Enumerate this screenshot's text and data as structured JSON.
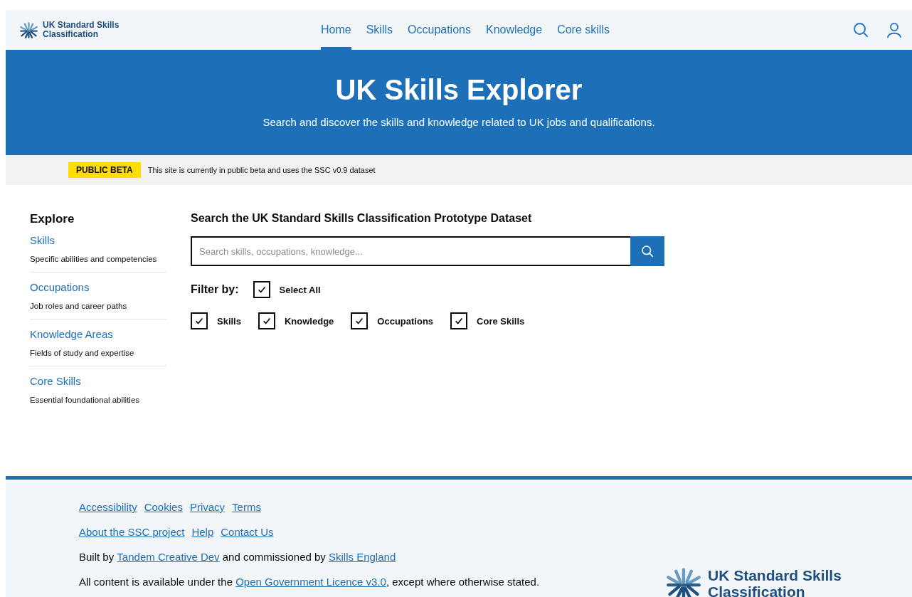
{
  "header": {
    "logo_text": "UK Standard Skills Classification",
    "nav": [
      {
        "label": "Home",
        "selected": true
      },
      {
        "label": "Skills",
        "selected": false
      },
      {
        "label": "Occupations",
        "selected": false
      },
      {
        "label": "Knowledge",
        "selected": false
      },
      {
        "label": "Core skills",
        "selected": false
      }
    ]
  },
  "hero": {
    "title": "UK Skills Explorer",
    "subtitle": "Search and discover the skills and knowledge related to UK jobs and qualifications."
  },
  "beta_banner": {
    "tag": "PUBLIC BETA",
    "text": "This site is currently in public beta and uses the SSC v0.9 dataset"
  },
  "sidebar": {
    "heading": "Explore",
    "items": [
      {
        "title": "Skills",
        "description": "Specific abilities and competencies"
      },
      {
        "title": "Occupations",
        "description": "Job roles and career paths"
      },
      {
        "title": "Knowledge Areas",
        "description": "Fields of study and expertise"
      },
      {
        "title": "Core Skills",
        "description": "Essential foundational abilities"
      }
    ]
  },
  "search": {
    "heading": "Search the UK Standard Skills Classification Prototype Dataset",
    "placeholder": "Search skills, occupations, knowledge...",
    "filter_label": "Filter by:",
    "select_all": {
      "label": "Select All",
      "checked": true
    },
    "filters": [
      {
        "label": "Skills",
        "checked": true
      },
      {
        "label": "Knowledge",
        "checked": true
      },
      {
        "label": "Occupations",
        "checked": true
      },
      {
        "label": "Core Skills",
        "checked": true
      }
    ]
  },
  "footer": {
    "link_rows": [
      [
        "Accessibility",
        "Cookies",
        "Privacy",
        "Terms"
      ],
      [
        "About the SSC project",
        "Help",
        "Contact Us"
      ]
    ],
    "built_by": [
      {
        "text": "Built by "
      },
      {
        "link": "Tandem Creative Dev"
      },
      {
        "text": " and commissioned by "
      },
      {
        "link": "Skills England"
      }
    ],
    "licence": [
      {
        "text": "All content is available under the "
      },
      {
        "link": "Open Government Licence v3.0"
      },
      {
        "text": ", except where otherwise stated."
      }
    ],
    "logo_text": "UK Standard Skills Classification"
  }
}
